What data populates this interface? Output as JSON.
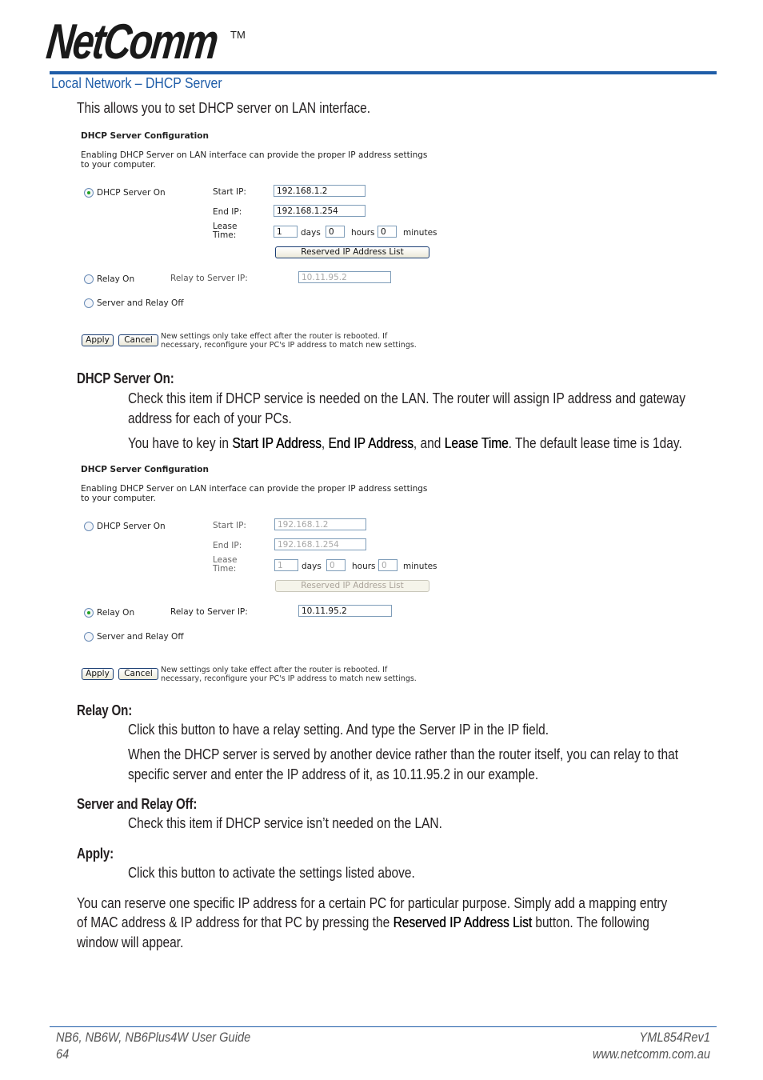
{
  "header": {
    "logo_text": "NetComm",
    "trademark": "TM",
    "section_title": "Local Network – DHCP Server",
    "intro": "This allows you to set DHCP server on LAN interface."
  },
  "colors": {
    "accent": "#1f5da8",
    "radio_selected": "#21a121",
    "field_border": "#7f9db9"
  },
  "panels": [
    {
      "title": "DHCP Server Configuration",
      "description_line1": "Enabling DHCP Server on LAN interface can provide the proper IP address settings",
      "description_line2": "to your computer.",
      "mode": "dhcp_server_on",
      "radio_dhcp_on": "DHCP Server On",
      "radio_relay_on": "Relay On",
      "radio_off": "Server and Relay Off",
      "start_ip_label": "Start IP:",
      "start_ip": "192.168.1.2",
      "end_ip_label": "End IP:",
      "end_ip": "192.168.1.254",
      "lease_label_1": "Lease",
      "lease_label_2": "Time:",
      "lease_days": "1",
      "days_label": "days",
      "lease_hours": "0",
      "hours_label": "hours",
      "lease_minutes": "0",
      "minutes_label": "minutes",
      "reserved_button": "Reserved IP Address List",
      "relay_label": "Relay to Server IP:",
      "relay_ip": "10.11.95.2",
      "apply_button": "Apply",
      "cancel_button": "Cancel",
      "note_line1": "New settings only take effect after the router is rebooted. If",
      "note_line2": "necessary, reconfigure your PC's IP address to match new settings."
    },
    {
      "title": "DHCP Server Configuration",
      "description_line1": "Enabling DHCP Server on LAN interface can provide the proper IP address settings",
      "description_line2": "to your computer.",
      "mode": "relay_on",
      "radio_dhcp_on": "DHCP Server On",
      "radio_relay_on": "Relay On",
      "radio_off": "Server and Relay Off",
      "start_ip_label": "Start IP:",
      "start_ip": "192.168.1.2",
      "end_ip_label": "End IP:",
      "end_ip": "192.168.1.254",
      "lease_label_1": "Lease",
      "lease_label_2": "Time:",
      "lease_days": "1",
      "days_label": "days",
      "lease_hours": "0",
      "hours_label": "hours",
      "lease_minutes": "0",
      "minutes_label": "minutes",
      "reserved_button": "Reserved IP Address List",
      "relay_label": "Relay to Server IP:",
      "relay_ip": "10.11.95.2",
      "apply_button": "Apply",
      "cancel_button": "Cancel",
      "note_line1": "New settings only take effect after the router is rebooted. If",
      "note_line2": "necessary, reconfigure your PC's IP address to match new settings."
    }
  ],
  "sections": {
    "dhcp_on": {
      "heading": "DHCP Server On:",
      "line1": "Check this item if DHCP service is needed on the LAN. The router will assign IP address and gateway",
      "line2": "address for each of your PCs.",
      "line3_pre": "You have to key in ",
      "line3_b1": "Start IP Address",
      "line3_sep1": ", ",
      "line3_b2": "End IP Address",
      "line3_sep2": ", and ",
      "line3_b3": "Lease Time",
      "line3_post": ". The default lease time is 1day."
    },
    "relay_on": {
      "heading": "Relay On:",
      "line1": "Click this button to have a relay setting. And type the Server IP in the IP field.",
      "line2": "When the DHCP server is served by another device rather than the router itself, you can relay to that",
      "line3": "specific server and enter the IP address of it, as 10.11.95.2 in our example."
    },
    "off": {
      "heading": "Server and Relay Off:",
      "line1": "Check this item if DHCP service isn’t needed on the LAN."
    },
    "apply": {
      "heading": "Apply:",
      "line1": "Click this button to activate the settings listed above."
    },
    "reserve": {
      "line1": "You can reserve one specific IP address for a certain PC for particular purpose. Simply add a mapping entry",
      "line2_pre": "of MAC address & IP address for that PC by pressing the ",
      "line2_b": "Reserved IP Address List",
      "line2_post": " button. The following",
      "line3": "window will appear."
    }
  },
  "footer": {
    "guide": "NB6, NB6W, NB6Plus4W User Guide",
    "page": "64",
    "doc_id": "YML854Rev1",
    "website": "www.netcomm.com.au"
  }
}
